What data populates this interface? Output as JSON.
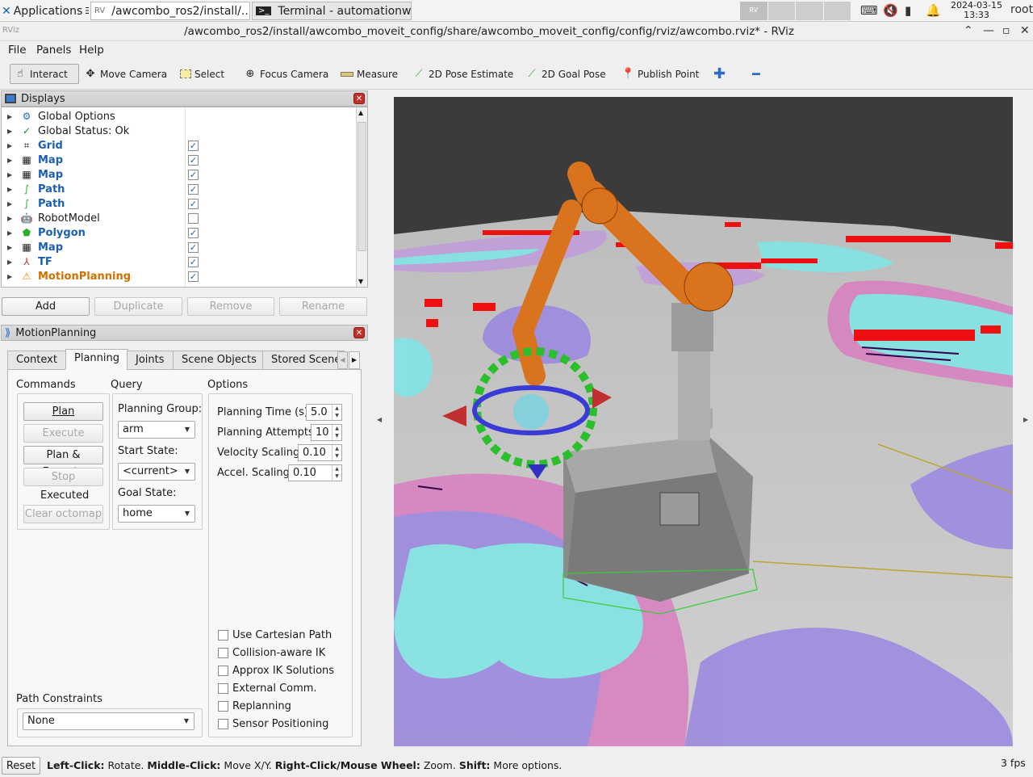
{
  "taskbar": {
    "apps_label": "Applications",
    "task1": "/awcombo_ros2/install/...",
    "task2": "Terminal - automationw...",
    "date": "2024-03-15",
    "time": "13:33",
    "user": "root"
  },
  "window": {
    "title": "/awcombo_ros2/install/awcombo_moveit_config/share/awcombo_moveit_config/config/rviz/awcombo.rviz* - RViz",
    "app_abbrev": "RViz"
  },
  "menu": {
    "file": "File",
    "panels": "Panels",
    "help": "Help"
  },
  "toolbar": {
    "interact": "Interact",
    "move_camera": "Move Camera",
    "select": "Select",
    "focus_camera": "Focus Camera",
    "measure": "Measure",
    "pose_estimate": "2D Pose Estimate",
    "goal_pose": "2D Goal Pose",
    "publish_point": "Publish Point"
  },
  "displays": {
    "title": "Displays",
    "items": [
      {
        "label": "Global Options",
        "checked": null
      },
      {
        "label": "Global Status: Ok",
        "checked": null
      },
      {
        "label": "Grid",
        "checked": true
      },
      {
        "label": "Map",
        "checked": true
      },
      {
        "label": "Map",
        "checked": true
      },
      {
        "label": "Path",
        "checked": true
      },
      {
        "label": "Path",
        "checked": true
      },
      {
        "label": "RobotModel",
        "checked": false
      },
      {
        "label": "Polygon",
        "checked": true
      },
      {
        "label": "Map",
        "checked": true
      },
      {
        "label": "TF",
        "checked": true
      },
      {
        "label": "MotionPlanning",
        "checked": true
      }
    ],
    "add": "Add",
    "duplicate": "Duplicate",
    "remove": "Remove",
    "rename": "Rename"
  },
  "motion": {
    "title": "MotionPlanning",
    "tabs": [
      "Context",
      "Planning",
      "Joints",
      "Scene Objects",
      "Stored Scenes"
    ],
    "commands_label": "Commands",
    "query_label": "Query",
    "options_label": "Options",
    "plan": "Plan",
    "execute": "Execute",
    "plan_execute": "Plan & Execute",
    "stop": "Stop",
    "executed": "Executed",
    "clear_octomap": "Clear octomap",
    "planning_group_label": "Planning Group:",
    "planning_group": "arm",
    "start_state_label": "Start State:",
    "start_state": "<current>",
    "goal_state_label": "Goal State:",
    "goal_state": "home",
    "planning_time_label": "Planning Time (s):",
    "planning_time": "5.0",
    "planning_attempts_label": "Planning Attempts:",
    "planning_attempts": "10",
    "velocity_label": "Velocity Scaling:",
    "velocity": "0.10",
    "accel_label": "Accel. Scaling:",
    "accel": "0.10",
    "checkboxes": [
      "Use Cartesian Path",
      "Collision-aware IK",
      "Approx IK Solutions",
      "External Comm.",
      "Replanning",
      "Sensor Positioning"
    ],
    "path_constraints_label": "Path Constraints",
    "path_constraints": "None"
  },
  "status": {
    "reset": "Reset",
    "left_click": "Left-Click:",
    "left_desc": "Rotate.",
    "middle_click": "Middle-Click:",
    "middle_desc": "Move X/Y.",
    "right_click": "Right-Click/Mouse Wheel:",
    "right_desc": "Zoom.",
    "shift": "Shift:",
    "shift_desc": "More options.",
    "fps": "3 fps"
  }
}
